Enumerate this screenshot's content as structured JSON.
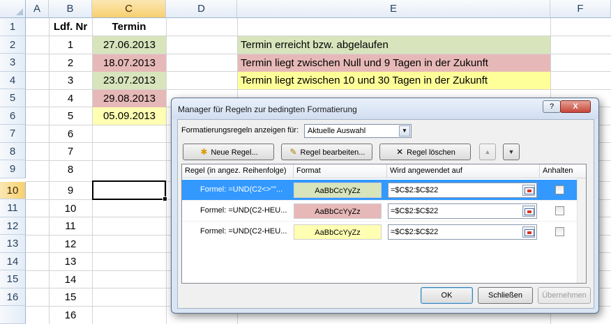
{
  "sheet": {
    "columns": [
      "A",
      "B",
      "C",
      "D",
      "E",
      "F"
    ],
    "rows": [
      "1",
      "2",
      "3",
      "4",
      "5",
      "6",
      "7",
      "8",
      "9",
      "10",
      "11",
      "12",
      "13",
      "14",
      "15",
      "16"
    ],
    "selected_column": "C",
    "selected_row": "10",
    "header_b": "Ldf. Nr",
    "header_c": "Termin",
    "numbers": [
      "1",
      "2",
      "3",
      "4",
      "5",
      "6",
      "7",
      "8",
      "9",
      "10",
      "11",
      "12",
      "13",
      "14",
      "15",
      "16"
    ],
    "dates": [
      "27.06.2013",
      "18.07.2013",
      "23.07.2013",
      "29.08.2013",
      "05.09.2013"
    ],
    "legend": [
      "Termin erreicht bzw. abgelaufen",
      "Termin liegt zwischen Null und 9 Tagen in der Zukunft",
      "Termin liegt zwischen 10 und 30 Tagen in der Zukunft"
    ],
    "colors": {
      "green": "#d8e4bc",
      "red": "#e6b9b8",
      "yellow": "#ffff99"
    }
  },
  "dialog": {
    "title": "Manager für Regeln zur bedingten Formatierung",
    "help_label": "?",
    "close_label": "X",
    "show_rules_label": "Formatierungsregeln anzeigen für:",
    "show_rules_value": "Aktuelle Auswahl",
    "new_rule": "Neue Regel...",
    "edit_rule": "Regel bearbeiten...",
    "delete_rule": "Regel löschen",
    "move_up": "▲",
    "move_down": "▼",
    "col_rule": "Regel (in angez. Reihenfolge)",
    "col_format": "Format",
    "col_applies": "Wird angewendet auf",
    "col_stop": "Anhalten",
    "rules": [
      {
        "formula": "Formel: =UND(C2<>\"\"...",
        "preview": "AaBbCcYyZz",
        "applies_to": "=$C$2:$C$22"
      },
      {
        "formula": "Formel: =UND(C2-HEU...",
        "preview": "AaBbCcYyZz",
        "applies_to": "=$C$2:$C$22"
      },
      {
        "formula": "Formel: =UND(C2-HEU...",
        "preview": "AaBbCcYyZz",
        "applies_to": "=$C$2:$C$22"
      }
    ],
    "ok": "OK",
    "close": "Schließen",
    "apply": "Übernehmen"
  }
}
